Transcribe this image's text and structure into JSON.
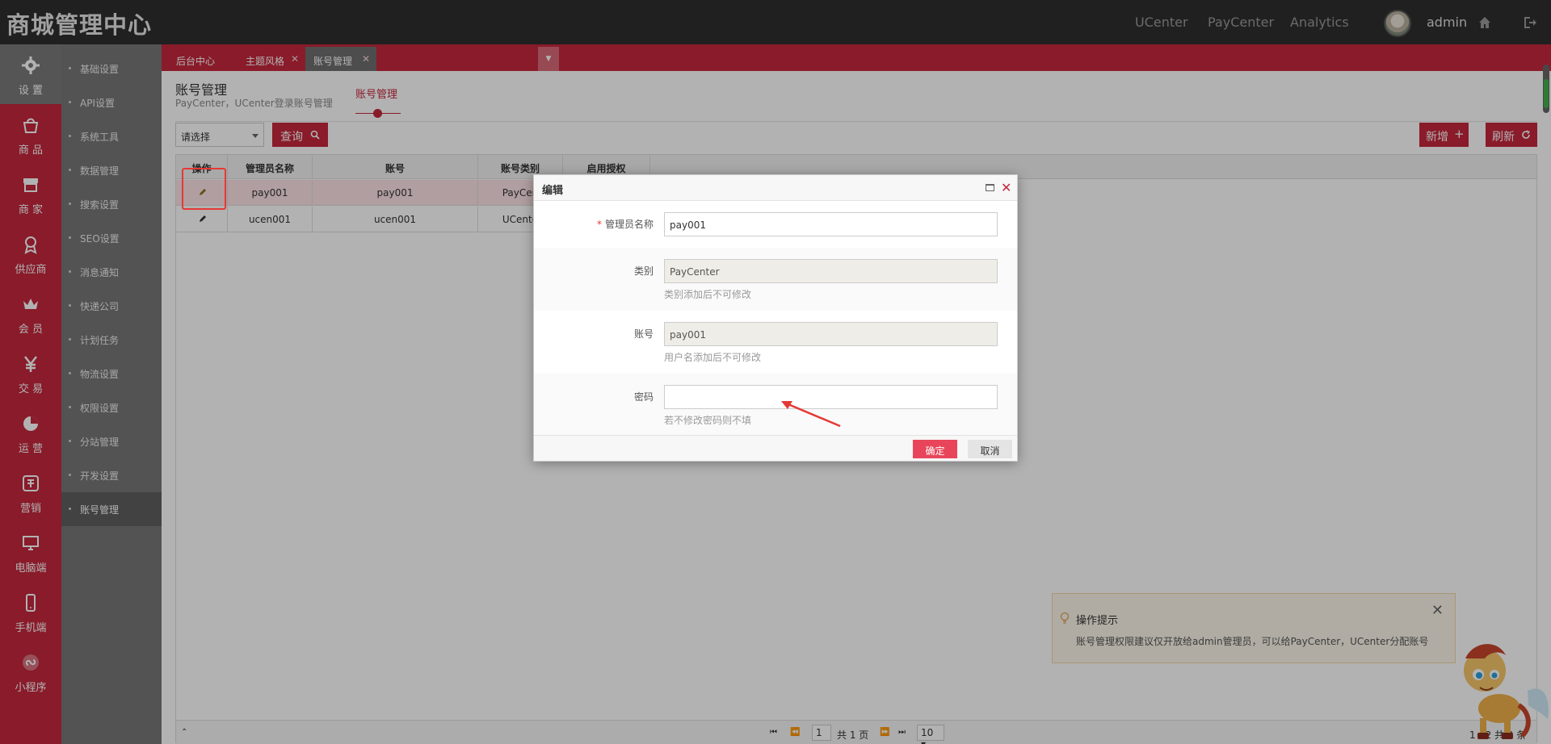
{
  "app": {
    "brand": "商城管理中心"
  },
  "topnav": [
    "UCenter",
    "PayCenter",
    "Analytics"
  ],
  "user": {
    "name": "admin"
  },
  "icon_nav": [
    {
      "label": "设 置",
      "icon": "gear-icon"
    },
    {
      "label": "商 品",
      "icon": "bag-icon"
    },
    {
      "label": "商 家",
      "icon": "store-icon"
    },
    {
      "label": "供应商",
      "icon": "badge-icon"
    },
    {
      "label": "会 员",
      "icon": "crown-icon"
    },
    {
      "label": "交 易",
      "icon": "yen-icon"
    },
    {
      "label": "运 营",
      "icon": "pie-icon"
    },
    {
      "label": "营销",
      "icon": "promo-icon"
    },
    {
      "label": "电脑端",
      "icon": "monitor-icon"
    },
    {
      "label": "手机端",
      "icon": "phone-icon"
    },
    {
      "label": "小程序",
      "icon": "miniapp-icon"
    }
  ],
  "sub_nav": [
    "基础设置",
    "API设置",
    "系统工具",
    "数据管理",
    "搜索设置",
    "SEO设置",
    "消息通知",
    "快递公司",
    "计划任务",
    "物流设置",
    "权限设置",
    "分站管理",
    "开发设置",
    "账号管理"
  ],
  "tabs": [
    {
      "label": "后台中心",
      "closable": false
    },
    {
      "label": "主题风格",
      "closable": true
    },
    {
      "label": "账号管理",
      "closable": true
    }
  ],
  "page": {
    "title": "账号管理",
    "subtitle": "PayCenter，UCenter登录账号管理",
    "content_tab": "账号管理"
  },
  "toolbar": {
    "select_value": "请选择",
    "query_label": "查询",
    "add_label": "新增",
    "refresh_label": "刷新"
  },
  "table": {
    "headers": [
      "操作",
      "管理员名称",
      "账号",
      "账号类别",
      "启用授权"
    ],
    "rows": [
      [
        "",
        "pay001",
        "pay001",
        "PayCen",
        ""
      ],
      [
        "",
        "ucen001",
        "ucen001",
        "UCente",
        ""
      ]
    ]
  },
  "pager": {
    "page": "1",
    "total_pages": "共 1 页",
    "page_size": "10",
    "range": "1 - 2 共 2 条"
  },
  "tip": {
    "title": "操作提示",
    "text": "账号管理权限建议仅开放给admin管理员，可以给PayCenter，UCenter分配账号"
  },
  "modal": {
    "title": "编辑",
    "fields": {
      "name_label": "管理员名称",
      "name_value": "pay001",
      "type_label": "类别",
      "type_value": "PayCenter",
      "type_hint": "类别添加后不可修改",
      "account_label": "账号",
      "account_value": "pay001",
      "account_hint": "用户名添加后不可修改",
      "password_label": "密码",
      "password_value": "",
      "password_hint": "若不修改密码则不填"
    },
    "confirm_label": "确定",
    "cancel_label": "取消"
  },
  "colors": {
    "brand_red": "#c5283d",
    "topbar": "#2f2f2f",
    "confirm": "#e8455a"
  }
}
